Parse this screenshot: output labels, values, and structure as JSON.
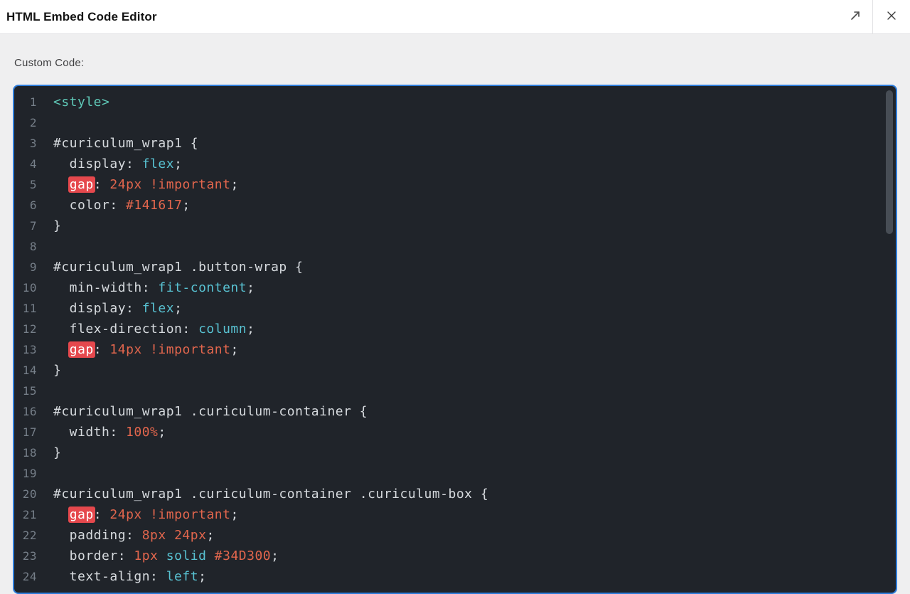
{
  "header": {
    "title": "HTML Embed Code Editor"
  },
  "main": {
    "custom_code_label": "Custom Code:"
  },
  "icons": {
    "expand": "expand-icon",
    "close": "close-icon"
  },
  "colors": {
    "focus_border": "#2e7cd9",
    "editor_bg": "#20242a",
    "plain_text": "#d6dade",
    "value_teal": "#58c2d2",
    "number_orange": "#e2664d",
    "tag_green": "#5fc9b8",
    "search_highlight_bg": "#e5484d",
    "line_number": "#767f89",
    "border_hex_in_code": "#34D300",
    "color_hex_in_code": "#141617"
  },
  "editor": {
    "start_line": 1,
    "lines": [
      [
        [
          "tag",
          "<style>"
        ]
      ],
      [],
      [
        [
          "p",
          "#curiculum_wrap1 {"
        ]
      ],
      [
        [
          "p",
          "  display: "
        ],
        [
          "v",
          "flex"
        ],
        [
          "p",
          ";"
        ]
      ],
      [
        [
          "p",
          "  "
        ],
        [
          "h",
          "gap"
        ],
        [
          "p",
          ": "
        ],
        [
          "n",
          "24px"
        ],
        [
          "p",
          " "
        ],
        [
          "n",
          "!important"
        ],
        [
          "p",
          ";"
        ]
      ],
      [
        [
          "p",
          "  color: "
        ],
        [
          "n",
          "#141617"
        ],
        [
          "p",
          ";"
        ]
      ],
      [
        [
          "p",
          "}"
        ]
      ],
      [],
      [
        [
          "p",
          "#curiculum_wrap1 .button-wrap {"
        ]
      ],
      [
        [
          "p",
          "  min-width: "
        ],
        [
          "v",
          "fit-content"
        ],
        [
          "p",
          ";"
        ]
      ],
      [
        [
          "p",
          "  display: "
        ],
        [
          "v",
          "flex"
        ],
        [
          "p",
          ";"
        ]
      ],
      [
        [
          "p",
          "  flex-direction: "
        ],
        [
          "v",
          "column"
        ],
        [
          "p",
          ";"
        ]
      ],
      [
        [
          "p",
          "  "
        ],
        [
          "h",
          "gap"
        ],
        [
          "p",
          ": "
        ],
        [
          "n",
          "14px"
        ],
        [
          "p",
          " "
        ],
        [
          "n",
          "!important"
        ],
        [
          "p",
          ";"
        ]
      ],
      [
        [
          "p",
          "}"
        ]
      ],
      [],
      [
        [
          "p",
          "#curiculum_wrap1 .curiculum-container {"
        ]
      ],
      [
        [
          "p",
          "  width: "
        ],
        [
          "n",
          "100%"
        ],
        [
          "p",
          ";"
        ]
      ],
      [
        [
          "p",
          "}"
        ]
      ],
      [],
      [
        [
          "p",
          "#curiculum_wrap1 .curiculum-container .curiculum-box {"
        ]
      ],
      [
        [
          "p",
          "  "
        ],
        [
          "h",
          "gap"
        ],
        [
          "p",
          ": "
        ],
        [
          "n",
          "24px"
        ],
        [
          "p",
          " "
        ],
        [
          "n",
          "!important"
        ],
        [
          "p",
          ";"
        ]
      ],
      [
        [
          "p",
          "  padding: "
        ],
        [
          "n",
          "8px"
        ],
        [
          "p",
          " "
        ],
        [
          "n",
          "24px"
        ],
        [
          "p",
          ";"
        ]
      ],
      [
        [
          "p",
          "  border: "
        ],
        [
          "n",
          "1px"
        ],
        [
          "p",
          " "
        ],
        [
          "v",
          "solid"
        ],
        [
          "p",
          " "
        ],
        [
          "n",
          "#34D300"
        ],
        [
          "p",
          ";"
        ]
      ],
      [
        [
          "p",
          "  text-align: "
        ],
        [
          "v",
          "left"
        ],
        [
          "p",
          ";"
        ]
      ]
    ]
  }
}
